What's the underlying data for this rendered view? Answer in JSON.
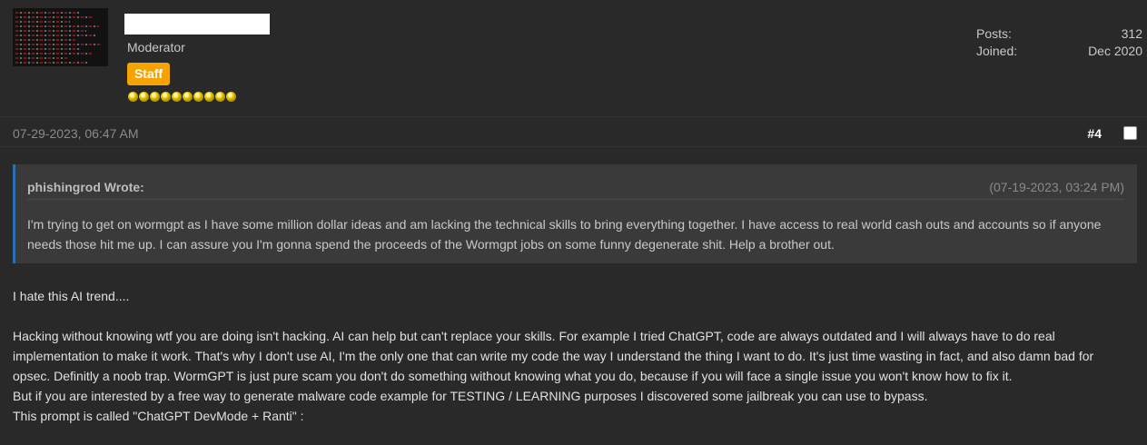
{
  "author": {
    "user_title": "Moderator",
    "badge": "Staff",
    "stars": 10,
    "stats": [
      {
        "label": "Posts:",
        "value": "312"
      },
      {
        "label": "Joined:",
        "value": "Dec 2020"
      }
    ]
  },
  "post": {
    "date": "07-29-2023, 06:47 AM",
    "number": "#4"
  },
  "quote": {
    "author": "phishingrod Wrote:",
    "date": "(07-19-2023, 03:24 PM)",
    "body": "I'm trying to get on wormgpt as I have some million dollar ideas and am lacking the technical skills to bring everything together. I have access to real world cash outs and accounts so if anyone needs those hit me up. I can assure you I'm gonna spend the proceeds of the Wormgpt jobs on some funny degenerate shit. Help a brother out."
  },
  "message": {
    "line1": "I hate this AI trend....",
    "para2": "Hacking without knowing wtf you are doing isn't hacking. AI can help but can't replace your skills. For example I tried ChatGPT, code are always outdated and I will always have to do real implementation to make it work. That's why I don't use AI, I'm the only one that can write my code the way I understand the thing I want to do. It's just time wasting in fact, and also damn bad for opsec. Definitly a noob trap. WormGPT is just pure scam you don't do something without knowing what you do, because if you will face a single issue you won't know how to fix it.",
    "line3": "But if you are interested by a free way to generate malware code example for TESTING / LEARNING purposes I discovered some jailbreak you can use to bypass.",
    "line4": "This prompt is called \"ChatGPT DevMode + Ranti\" :"
  },
  "colors": {
    "background": "#292929",
    "badge": "#f5a300",
    "quote_border": "#2b6fb6",
    "quote_bg": "#3a3a3a"
  }
}
